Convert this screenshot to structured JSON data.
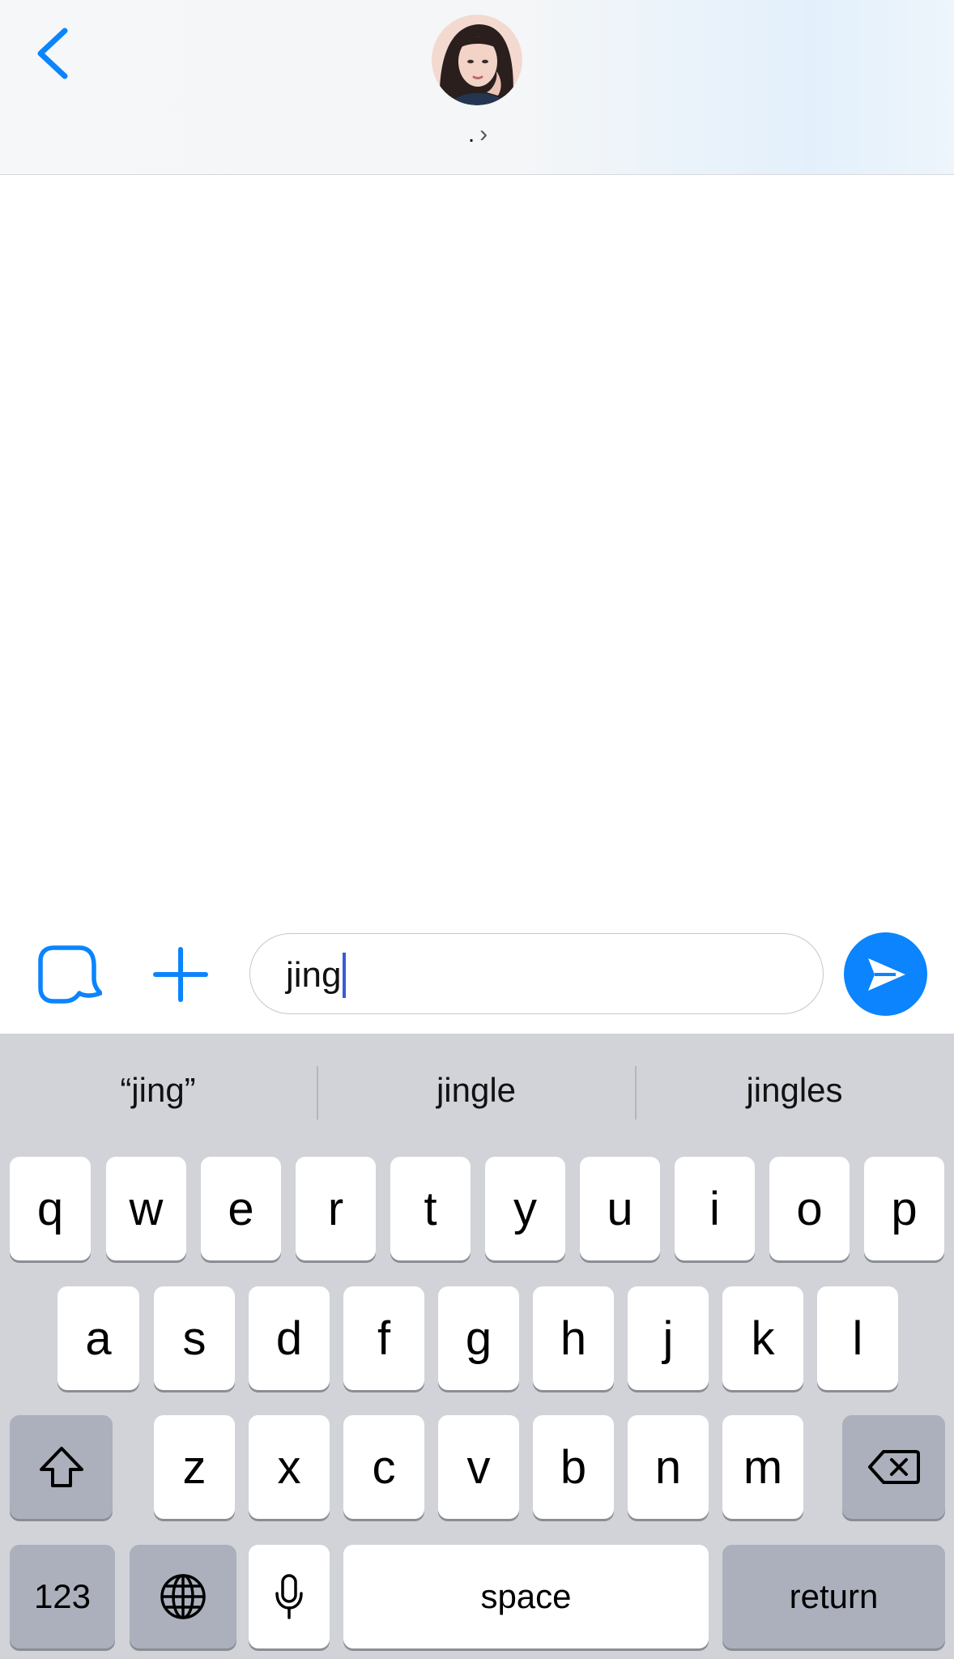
{
  "header": {
    "contact_name": ".",
    "chevron": "›",
    "back_icon": "chevron-left-icon"
  },
  "composer": {
    "message_text": "jing",
    "icons": [
      "stickers-icon",
      "plus-icon",
      "send-arrow-icon"
    ]
  },
  "keyboard": {
    "suggestions": [
      "“jing”",
      "jingle",
      "jingles"
    ],
    "row1": [
      "q",
      "w",
      "e",
      "r",
      "t",
      "y",
      "u",
      "i",
      "o",
      "p"
    ],
    "row2": [
      "a",
      "s",
      "d",
      "f",
      "g",
      "h",
      "j",
      "k",
      "l"
    ],
    "row3": [
      "z",
      "x",
      "c",
      "v",
      "b",
      "n",
      "m"
    ],
    "numbers_label": "123",
    "space_label": "space",
    "return_label": "return",
    "icons": [
      "shift-icon",
      "delete-icon",
      "globe-icon",
      "microphone-icon"
    ]
  },
  "colors": {
    "accent": "#0b84fe",
    "keyboard_bg": "#d1d3d9",
    "dark_key": "#abb0bc",
    "caret": "#3a5bd9"
  }
}
